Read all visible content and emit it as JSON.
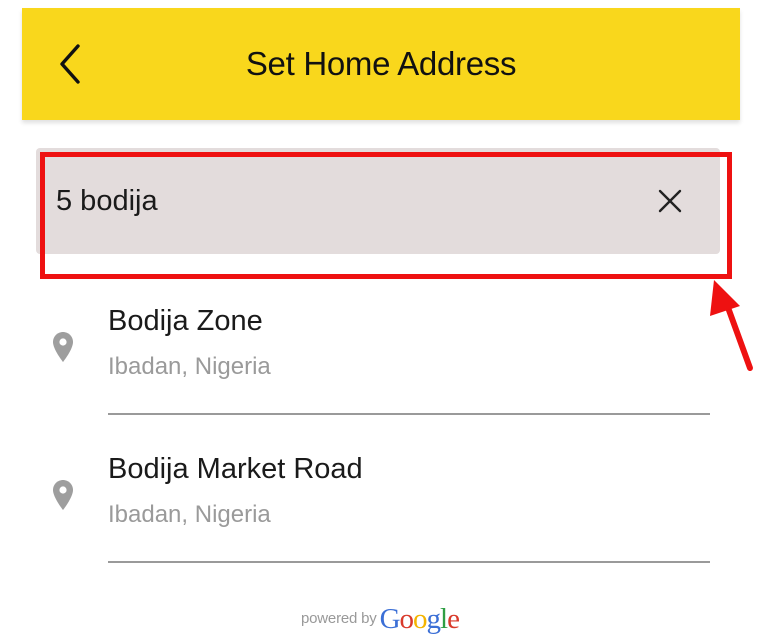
{
  "header": {
    "title": "Set Home Address",
    "back_icon": "chevron-left-icon",
    "background": "#f9d71c"
  },
  "search": {
    "value": "5 bodija",
    "clear_icon": "close-icon",
    "background": "#e3dcdc"
  },
  "results": [
    {
      "title": "Bodija Zone",
      "subtitle": "Ibadan, Nigeria",
      "icon": "location-pin-icon"
    },
    {
      "title": "Bodija Market Road",
      "subtitle": "Ibadan, Nigeria",
      "icon": "location-pin-icon"
    }
  ],
  "attribution": {
    "prefix": "powered by",
    "brand_letters": [
      "G",
      "o",
      "o",
      "g",
      "l",
      "e"
    ],
    "brand_colors": [
      "#3b6fd6",
      "#d93a2b",
      "#f4b400",
      "#3b6fd6",
      "#2f9e44",
      "#d93a2b"
    ]
  },
  "annotation": {
    "color": "#ee1111"
  }
}
